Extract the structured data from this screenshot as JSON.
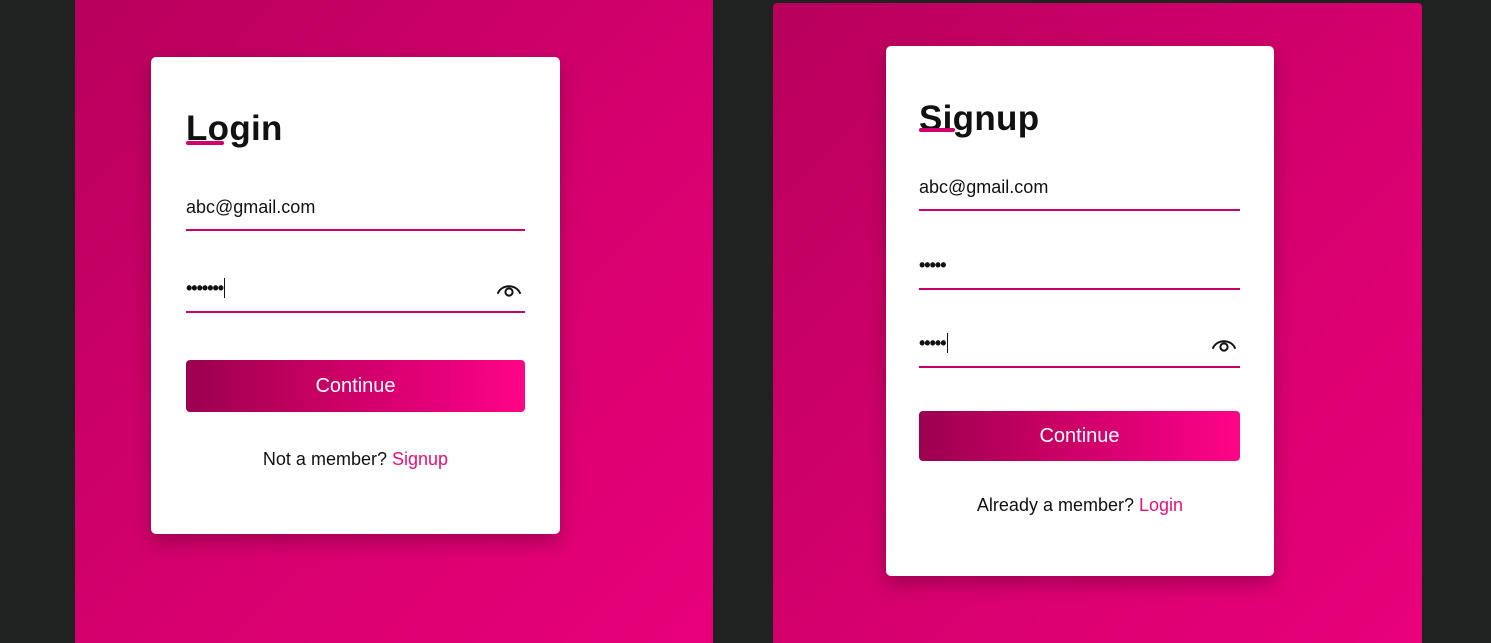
{
  "login": {
    "title": "Login",
    "email_value": "abc@gmail.com",
    "password_mask": "•••••••",
    "continue_label": "Continue",
    "switch_prompt": "Not a member?",
    "switch_link": "Signup"
  },
  "signup": {
    "title": "Signup",
    "email_value": "abc@gmail.com",
    "password_mask": "•••••",
    "confirm_password_mask": "•••••",
    "continue_label": "Continue",
    "switch_prompt": "Already a member?",
    "switch_link": "Login"
  },
  "icons": {
    "password_toggle": "eye-icon"
  },
  "colors": {
    "accent": "#e80f78",
    "background": "#202221",
    "panel_gradient_start": "#b8005c",
    "panel_gradient_end": "#e8007a",
    "button_gradient_start": "#9c0050",
    "button_gradient_end": "#ff0585"
  }
}
